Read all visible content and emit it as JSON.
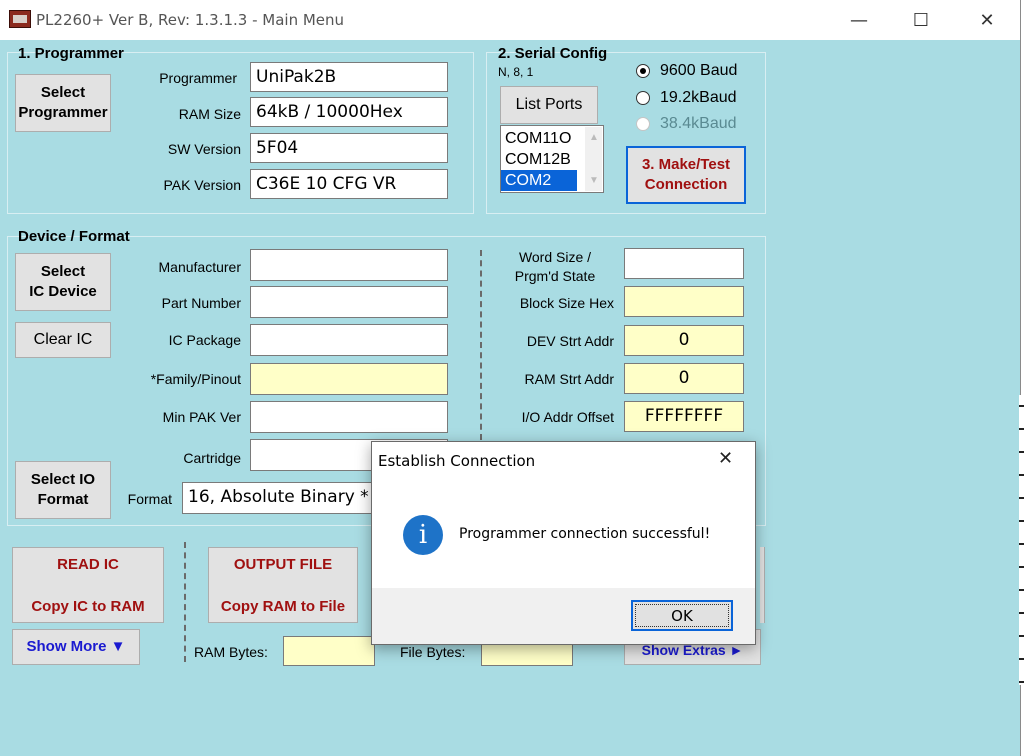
{
  "window": {
    "title": "PL2260+ Ver B, Rev: 1.3.1.3 - Main Menu",
    "minimize": "—",
    "maximize": "☐",
    "close": "✕"
  },
  "programmer": {
    "group_label": "1. Programmer",
    "select_button": "Select\nProgrammer",
    "fields": [
      {
        "label": "Programmer",
        "value": "UniPak2B"
      },
      {
        "label": "RAM Size",
        "value": "64kB / 10000Hex"
      },
      {
        "label": "SW Version",
        "value": "5F04"
      },
      {
        "label": "PAK Version",
        "value": "C36E 10 CFG VR"
      }
    ]
  },
  "serial": {
    "group_label": "2. Serial Config",
    "subtitle": "N, 8, 1",
    "list_ports_button": "List Ports",
    "ports": [
      "COM11O",
      "COM12B",
      "COM2"
    ],
    "selected_port": "COM2",
    "baud_options": [
      {
        "label": "9600 Baud",
        "checked": true,
        "enabled": true
      },
      {
        "label": "19.2kBaud",
        "checked": false,
        "enabled": true
      },
      {
        "label": "38.4kBaud",
        "checked": false,
        "enabled": false
      }
    ],
    "make_test_button": "3. Make/Test\nConnection"
  },
  "device": {
    "group_label": "Device / Format",
    "select_ic_button": "Select\nIC Device",
    "clear_ic_button": "Clear IC",
    "select_io_button": "Select IO\nFormat",
    "left_fields": [
      {
        "label": "Manufacturer",
        "value": ""
      },
      {
        "label": "Part Number",
        "value": ""
      },
      {
        "label": "IC Package",
        "value": ""
      },
      {
        "label": "*Family/Pinout",
        "value": ""
      },
      {
        "label": "Min PAK Ver",
        "value": ""
      },
      {
        "label": "Cartridge",
        "value": ""
      }
    ],
    "format_label": "Format",
    "format_value": "16, Absolute Binary *",
    "right_fields": [
      {
        "label": "Word Size /\nPrgm'd State",
        "value": ""
      },
      {
        "label": "Block Size Hex",
        "value": ""
      },
      {
        "label": "DEV Strt Addr",
        "value": "0"
      },
      {
        "label": "RAM Strt Addr",
        "value": "0"
      },
      {
        "label": "I/O Addr Offset",
        "value": "FFFFFFFF"
      }
    ]
  },
  "actions": {
    "read_ic_title": "READ IC",
    "read_ic_sub": "Copy IC to RAM",
    "output_file_title": "OUTPUT FILE",
    "output_file_sub": "Copy RAM to File",
    "show_more": "Show More ▼",
    "show_extras": "Show Extras ►",
    "ram_bytes_label": "RAM Bytes:",
    "ram_bytes_value": "",
    "file_bytes_label": "File Bytes:",
    "file_bytes_value": ""
  },
  "dialog": {
    "title": "Establish Connection",
    "close": "✕",
    "icon": "i",
    "message": "Programmer connection successful!",
    "ok": "OK"
  },
  "colors": {
    "window_bg": "#a9dce3",
    "field_yellow": "#ffffc8",
    "accent_blue": "#0a64d8",
    "button_red_text": "#a01010"
  }
}
